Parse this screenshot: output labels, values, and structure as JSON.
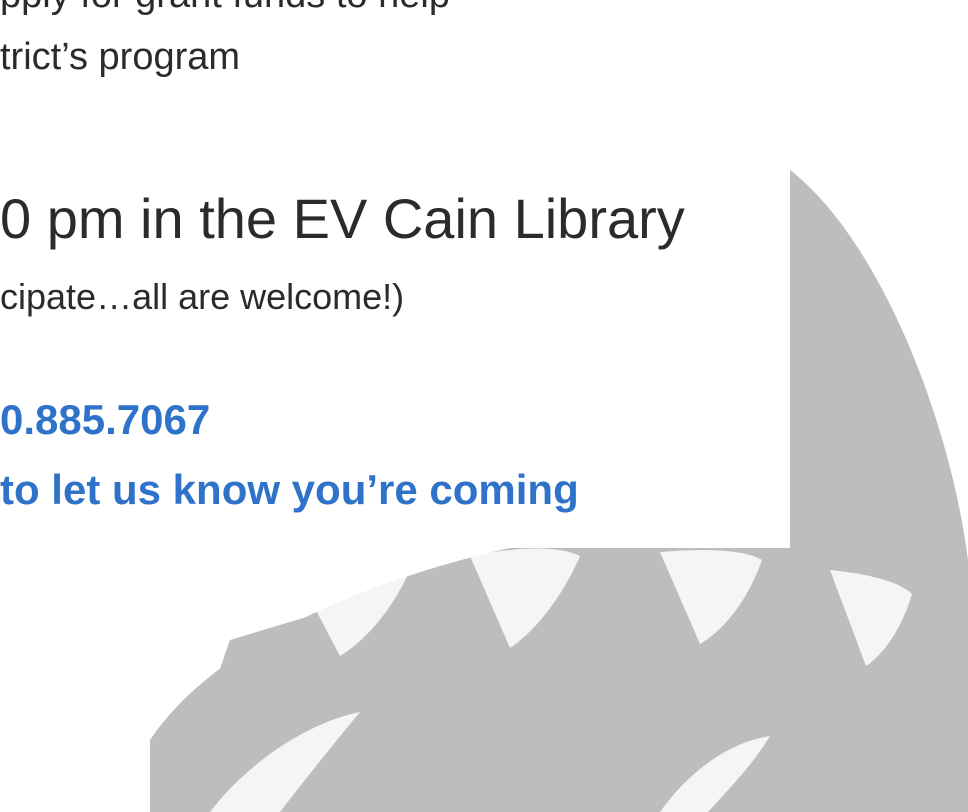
{
  "texts": {
    "line1": "pply for grant funds to help",
    "line2": "trict’s program",
    "line3": "0 pm in the EV Cain Library",
    "line4": "cipate…all are welcome!)",
    "line5": "0.885.7067",
    "line6": "to let us know you’re coming"
  },
  "colors": {
    "body_text": "#2b2b2b",
    "link_text": "#2f72c9",
    "watermark": "#bdbdbd",
    "background": "#ffffff"
  },
  "icons": {
    "watermark": "capitol-dome-icon"
  }
}
